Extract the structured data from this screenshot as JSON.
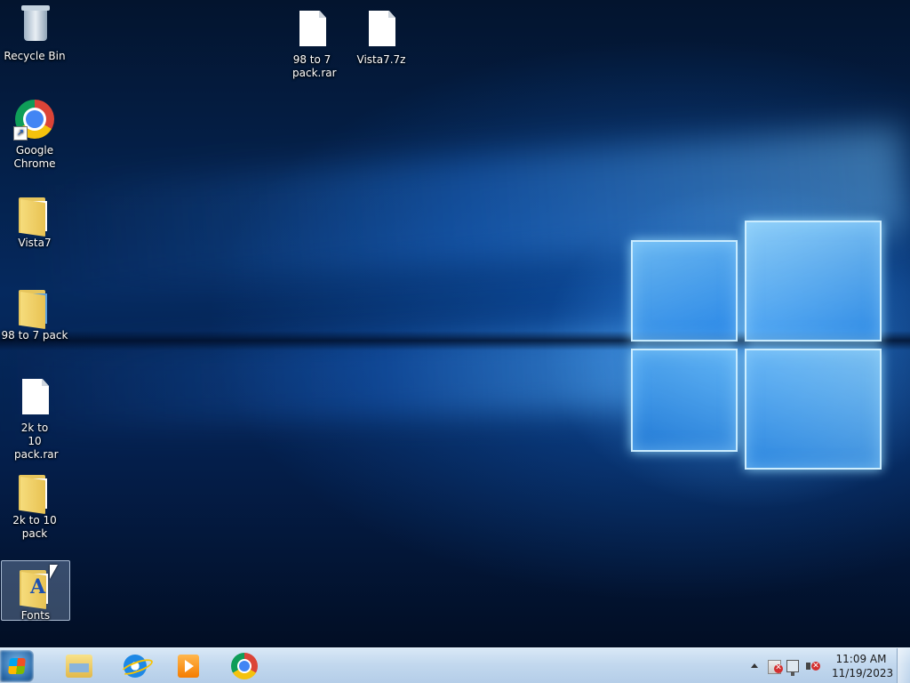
{
  "desktop": {
    "icons": [
      {
        "label": "Recycle Bin"
      },
      {
        "label": "98 to 7 pack.rar"
      },
      {
        "label": "Vista7.7z"
      },
      {
        "label": "Google Chrome"
      },
      {
        "label": "Vista7"
      },
      {
        "label": "98 to 7 pack"
      },
      {
        "label": "2k to 10 pack.rar"
      },
      {
        "label": "2k to 10 pack"
      },
      {
        "label": "Fonts",
        "selected": true
      }
    ]
  },
  "taskbar": {
    "pinned": [
      {
        "icon": "file-explorer-icon"
      },
      {
        "icon": "internet-explorer-icon"
      },
      {
        "icon": "windows-media-player-icon"
      },
      {
        "icon": "google-chrome-icon"
      }
    ],
    "tray": {
      "icons": [
        "show-hidden-icons-chevron",
        "action-center-flag-icon",
        "network-icon",
        "volume-muted-icon"
      ]
    },
    "clock": {
      "time": "11:09 AM",
      "date": "11/19/2023"
    }
  },
  "colors": {
    "taskbar": "#c2d8ee",
    "desktop_bg": "#05295e",
    "logo_glow": "#78c8ff"
  }
}
